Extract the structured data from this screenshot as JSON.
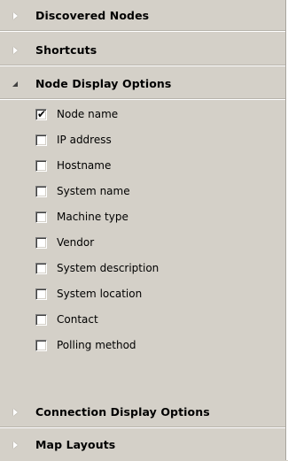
{
  "sections": {
    "discovered_nodes": {
      "title": "Discovered Nodes",
      "expanded": false
    },
    "shortcuts": {
      "title": "Shortcuts",
      "expanded": false
    },
    "node_display_options": {
      "title": "Node Display Options",
      "expanded": true
    },
    "connection_display_options": {
      "title": "Connection Display Options",
      "expanded": false
    },
    "map_layouts": {
      "title": "Map Layouts",
      "expanded": false
    }
  },
  "options": [
    {
      "label": "Node name",
      "checked": true
    },
    {
      "label": "IP address",
      "checked": false
    },
    {
      "label": "Hostname",
      "checked": false
    },
    {
      "label": "System name",
      "checked": false
    },
    {
      "label": "Machine type",
      "checked": false
    },
    {
      "label": "Vendor",
      "checked": false
    },
    {
      "label": "System description",
      "checked": false
    },
    {
      "label": "System location",
      "checked": false
    },
    {
      "label": "Contact",
      "checked": false
    },
    {
      "label": "Polling method",
      "checked": false
    }
  ],
  "icons": {
    "collapsed": "triangle-right-icon",
    "expanded": "triangle-down-icon",
    "check": "✔"
  }
}
